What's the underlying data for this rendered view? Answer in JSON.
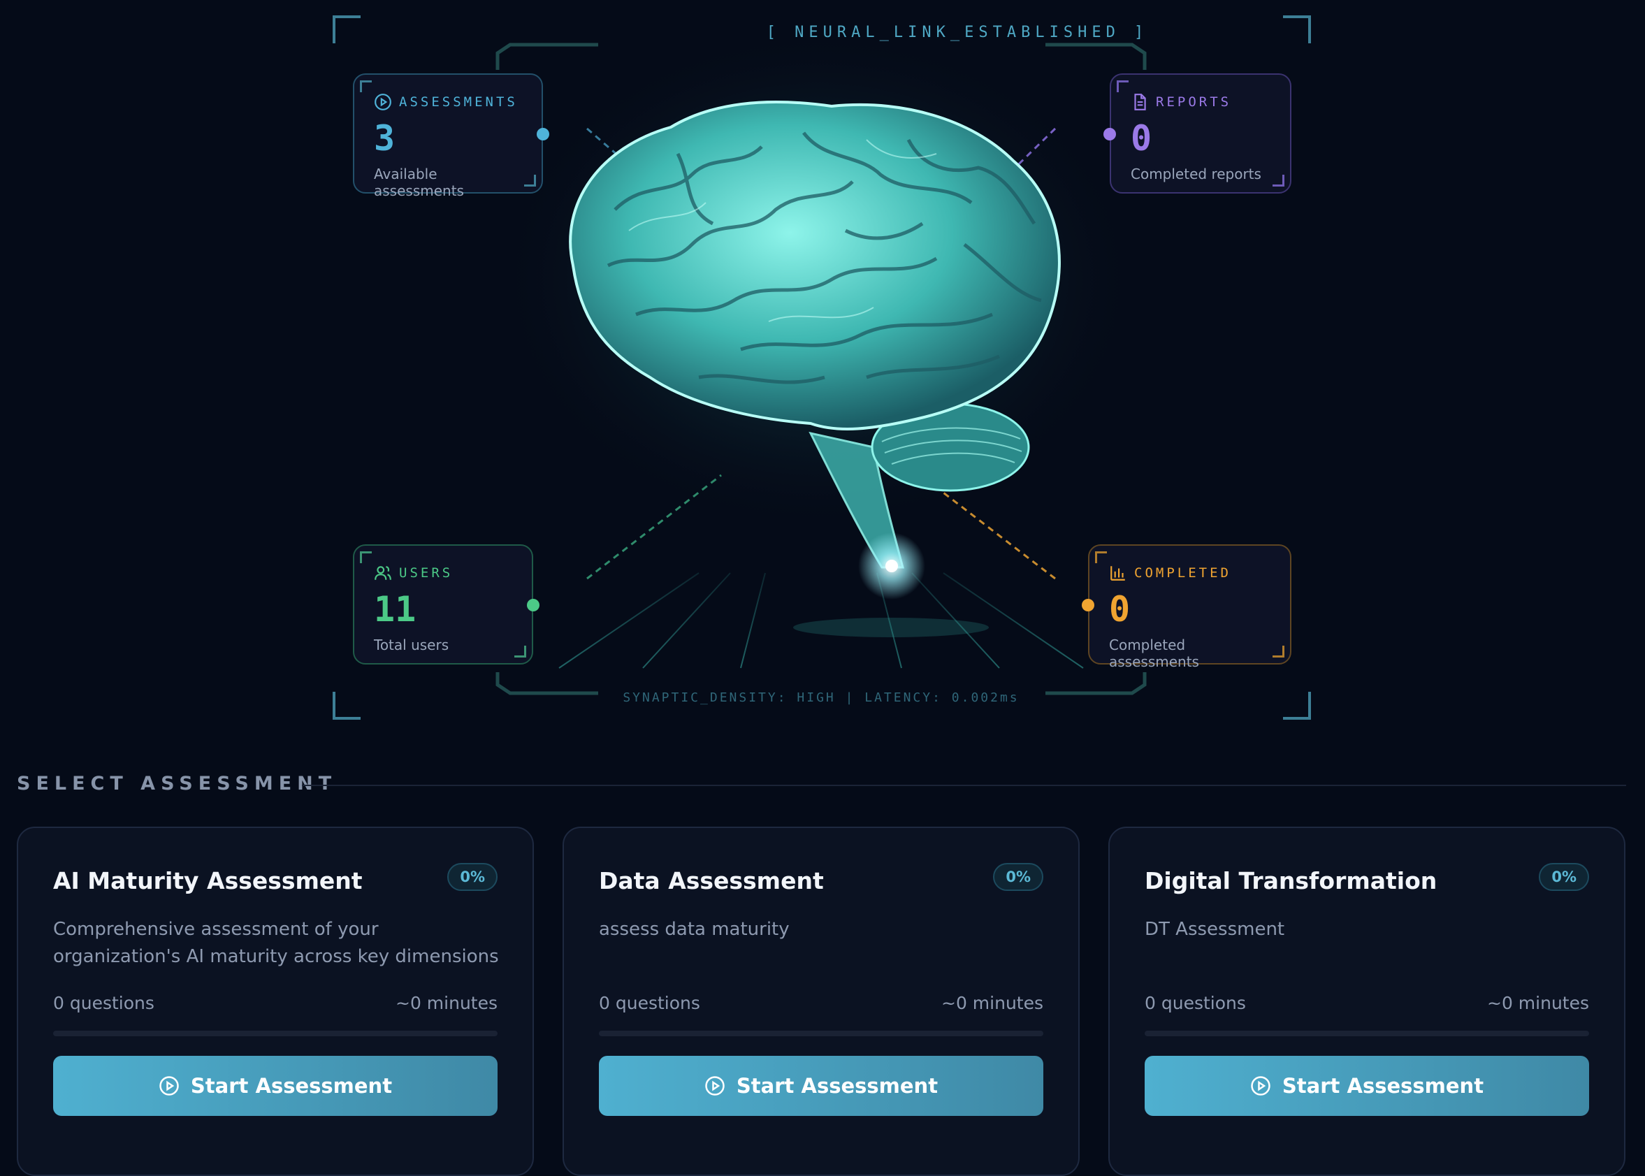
{
  "hero": {
    "status_title": "[ NEURAL_LINK_ESTABLISHED ]",
    "footer_text": "SYNAPTIC_DENSITY: HIGH  |  LATENCY: 0.002ms"
  },
  "stats": [
    {
      "label": "ASSESSMENTS",
      "value": "3",
      "desc": "Available assessments",
      "icon": "play-circle-icon",
      "color": "#4fb3d9"
    },
    {
      "label": "REPORTS",
      "value": "0",
      "desc": "Completed reports",
      "icon": "document-icon",
      "color": "#9b7ae8"
    },
    {
      "label": "USERS",
      "value": "11",
      "desc": "Total users",
      "icon": "users-icon",
      "color": "#4cc987"
    },
    {
      "label": "COMPLETED",
      "value": "0",
      "desc": "Completed assessments",
      "icon": "bar-chart-icon",
      "color": "#f0a431"
    }
  ],
  "section": {
    "title": "SELECT ASSESSMENT"
  },
  "assessments": [
    {
      "title": "AI Maturity Assessment",
      "progress": "0%",
      "progress_value": 0,
      "description": "Comprehensive assessment of your organization's AI maturity across key dimensions",
      "questions": "0 questions",
      "duration": "~0 minutes",
      "button": "Start Assessment"
    },
    {
      "title": "Data Assessment",
      "progress": "0%",
      "progress_value": 0,
      "description": "assess data maturity",
      "questions": "0 questions",
      "duration": "~0 minutes",
      "button": "Start Assessment"
    },
    {
      "title": "Digital Transformation",
      "progress": "0%",
      "progress_value": 0,
      "description": "DT Assessment",
      "questions": "0 questions",
      "duration": "~0 minutes",
      "button": "Start Assessment"
    }
  ]
}
